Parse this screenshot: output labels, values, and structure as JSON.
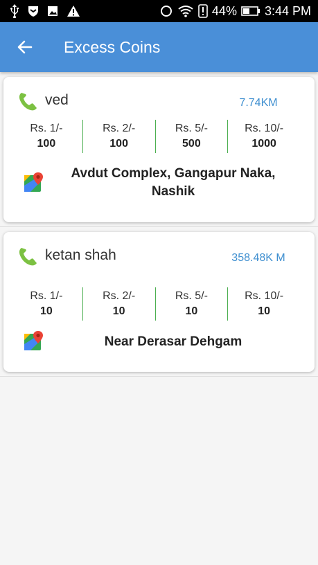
{
  "status_bar": {
    "battery_percent": "44%",
    "time": "3:44 PM",
    "left_icons": [
      "usb-icon",
      "shield-icon",
      "image-icon",
      "warning-icon"
    ],
    "right_icons": [
      "circle-icon",
      "wifi-icon",
      "alert-icon",
      "battery-icon"
    ]
  },
  "app_bar": {
    "title": "Excess Coins",
    "back_icon": "arrow-left-icon",
    "background": "#4a8fd8"
  },
  "colors": {
    "phone_icon": "#7cc142",
    "divider": "#4caf50",
    "distance_text": "#3f8fd0"
  },
  "cards": [
    {
      "name": "ved",
      "distance": "7.74KM",
      "denominations": [
        {
          "label": "Rs. 1/-",
          "count": "100"
        },
        {
          "label": "Rs. 2/-",
          "count": "100"
        },
        {
          "label": "Rs. 5/-",
          "count": "500"
        },
        {
          "label": "Rs. 10/-",
          "count": "1000"
        }
      ],
      "address": "Avdut Complex, Gangapur Naka, Nashik"
    },
    {
      "name": "ketan shah",
      "distance": "358.48K M",
      "denominations": [
        {
          "label": "Rs. 1/-",
          "count": "10"
        },
        {
          "label": "Rs. 2/-",
          "count": "10"
        },
        {
          "label": "Rs. 5/-",
          "count": "10"
        },
        {
          "label": "Rs. 10/-",
          "count": "10"
        }
      ],
      "address": "Near Derasar Dehgam"
    }
  ]
}
